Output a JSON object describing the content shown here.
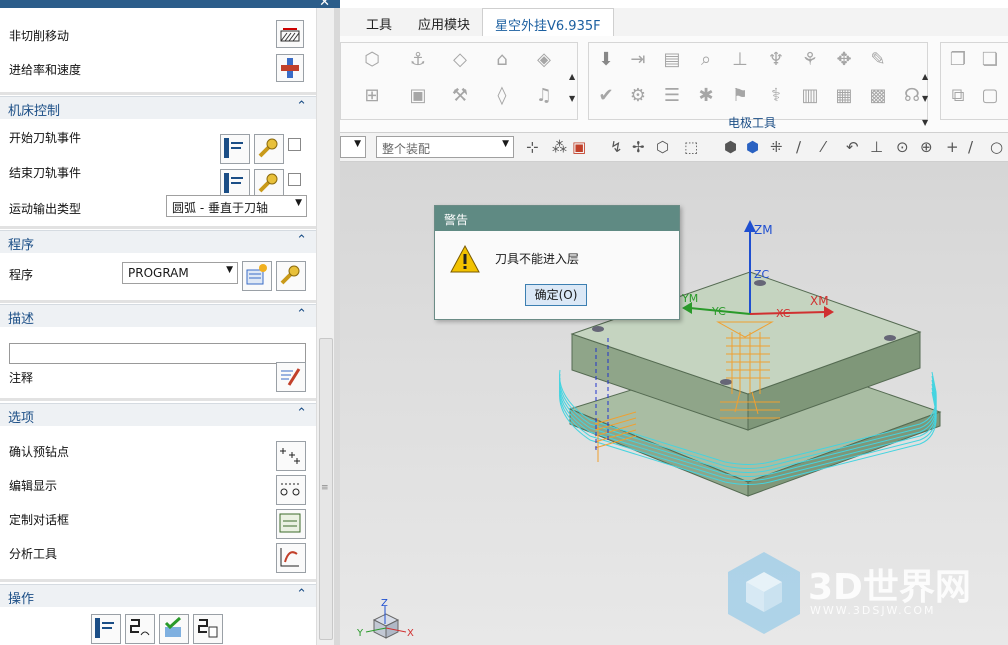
{
  "left_panel": {
    "rows_top": [
      {
        "label": "非切削移动"
      },
      {
        "label": "进给率和速度"
      }
    ],
    "machine_control": {
      "title": "机床控制",
      "start_event": "开始刀轨事件",
      "end_event": "结束刀轨事件",
      "motion_type_label": "运动输出类型",
      "motion_type_value": "圆弧 - 垂直于刀轴"
    },
    "program": {
      "title": "程序",
      "label": "程序",
      "value": "PROGRAM"
    },
    "description": {
      "title": "描述",
      "notes_label": "注释"
    },
    "options": {
      "title": "选项",
      "items": [
        "确认预钻点",
        "编辑显示",
        "定制对话框",
        "分析工具"
      ]
    },
    "actions": {
      "title": "操作"
    }
  },
  "menubar": {
    "tabs": [
      "工具",
      "应用模块",
      "星空外挂V6.935F"
    ],
    "active": "星空外挂V6.935F"
  },
  "ribbon": {
    "group_label": "电极工具"
  },
  "selection": {
    "filter_value": "整个装配"
  },
  "dialog": {
    "title": "警告",
    "message": "刀具不能进入层",
    "ok_label": "确定(O)"
  },
  "axes": {
    "zm": "ZM",
    "zc": "ZC",
    "xm": "XM",
    "xc": "XC",
    "ym": "YM",
    "yc": "YC"
  },
  "triad": {
    "z": "Z",
    "x": "X",
    "y": "Y"
  },
  "watermark": {
    "brand": "3D世界网",
    "url": "WWW.3DSJW.COM"
  },
  "colors": {
    "section_title": "#1b4e86",
    "dialog_bar": "#5f8a83",
    "toolpath": "#f0a030",
    "coolant": "#44d4e0"
  }
}
